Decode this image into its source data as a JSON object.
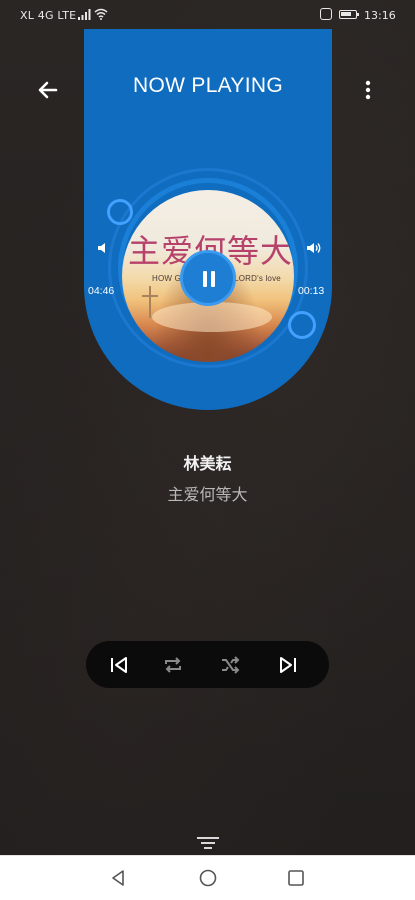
{
  "status_bar": {
    "carrier": "XL 4G LTE",
    "time": "13:16",
    "icons": [
      "signal-icon",
      "wifi-icon",
      "nfc-icon",
      "battery-icon"
    ]
  },
  "header": {
    "title": "NOW PLAYING",
    "back_icon": "arrow-left-icon",
    "menu_icon": "more-vertical-icon"
  },
  "player": {
    "elapsed": "04:46",
    "remaining": "00:13",
    "album_art_title": "主爱何等大",
    "album_art_subtitle": "HOW GREAT IS THE LORD's love",
    "state": "playing",
    "play_icon": "pause-icon",
    "volume_down_icon": "volume-low-icon",
    "volume_up_icon": "volume-high-icon"
  },
  "track": {
    "artist": "林美耘",
    "title": "主爱何等大"
  },
  "controls": {
    "prev_icon": "skip-previous-icon",
    "repeat_icon": "repeat-icon",
    "shuffle_icon": "shuffle-icon",
    "next_icon": "skip-next-icon"
  },
  "colors": {
    "accent": "#0f6cbf",
    "ring": "#1a7fd6",
    "knob": "#42a0ff",
    "background": "#262321",
    "control_bar": "#0b0b0b"
  }
}
